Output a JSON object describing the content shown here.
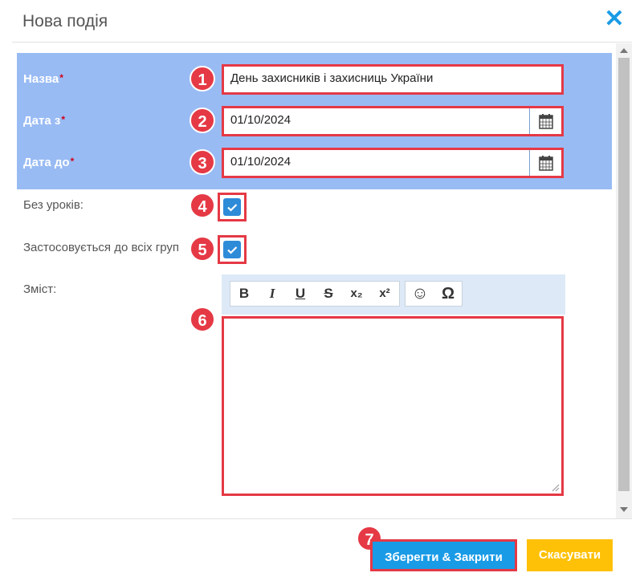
{
  "dialog": {
    "title": "Нова подія",
    "close_icon": "close-x-icon"
  },
  "form": {
    "name": {
      "label": "Назва",
      "required_mark": "*",
      "value": "День захисників і захисниць України",
      "badge": "1"
    },
    "date_from": {
      "label": "Дата з",
      "required_mark": "*",
      "value": "01/10/2024",
      "badge": "2",
      "icon": "calendar-icon"
    },
    "date_to": {
      "label": "Дата до",
      "required_mark": "*",
      "value": "01/10/2024",
      "badge": "3",
      "icon": "calendar-icon"
    },
    "no_lessons": {
      "label": "Без уроків:",
      "checked": true,
      "badge": "4"
    },
    "all_groups": {
      "label": "Застосовується до всіх груп",
      "checked": true,
      "badge": "5"
    },
    "content": {
      "label": "Зміст:",
      "badge": "6",
      "value": "",
      "toolbar": {
        "bold": "B",
        "italic": "I",
        "underline": "U",
        "strike": "S",
        "subscript": "x₂",
        "superscript": "x²",
        "smiley": "☺",
        "omega": "Ω"
      }
    }
  },
  "footer": {
    "save_close_label": "Зберегти & Закрити",
    "save_badge": "7",
    "cancel_label": "Скасувати"
  },
  "colors": {
    "accent_blue": "#1a9be6",
    "highlight": "#99bbf4",
    "annotation_red": "#e53945",
    "cancel_yellow": "#ffc107"
  }
}
